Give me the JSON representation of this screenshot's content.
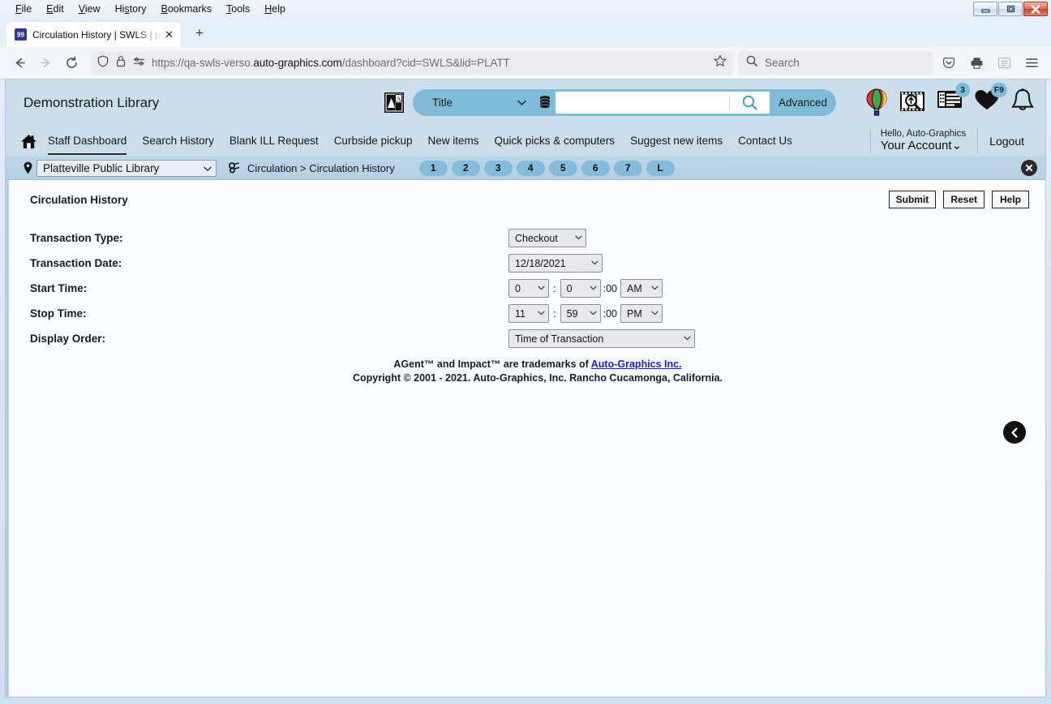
{
  "browser": {
    "menus": [
      "File",
      "Edit",
      "View",
      "History",
      "Bookmarks",
      "Tools",
      "Help"
    ],
    "tab_title": "Circulation History | SWLS | plat",
    "new_tab_label": "+",
    "tab_close_label": "✕",
    "url": "https://qa-swls-verso.auto-graphics.com/dashboard?cid=SWLS&lid=PLATT",
    "url_host_bold": "auto-graphics.com",
    "url_prefix": "https://qa-swls-verso.",
    "url_suffix": "/dashboard?cid=SWLS&lid=PLATT",
    "search_placeholder": "Search",
    "window_controls": {
      "minimize": "–",
      "maximize": "□",
      "close": "✕"
    }
  },
  "site": {
    "library_name": "Demonstration Library",
    "search": {
      "type_label": "Title",
      "input_value": "",
      "advanced_label": "Advanced"
    },
    "header_icons": [
      {
        "name": "hot-air-balloon-icon",
        "badge": ""
      },
      {
        "name": "film-search-icon",
        "badge": ""
      },
      {
        "name": "list-records-icon",
        "badge": "3"
      },
      {
        "name": "heart-favorites-icon",
        "badge": "F9"
      },
      {
        "name": "bell-notifications-icon",
        "badge": ""
      }
    ],
    "nav_links": [
      "Staff Dashboard",
      "Search History",
      "Blank ILL Request",
      "Curbside pickup",
      "New items",
      "Quick picks & computers",
      "Suggest new items",
      "Contact Us"
    ],
    "nav_active": "Staff Dashboard",
    "account": {
      "greeting": "Hello, Auto-Graphics",
      "menu_label": "Your Account",
      "logout_label": "Logout"
    }
  },
  "crumbbar": {
    "library_select_value": "Platteville Public Library",
    "breadcrumb": "Circulation > Circulation History",
    "pills": [
      "1",
      "2",
      "3",
      "4",
      "5",
      "6",
      "7",
      "L"
    ],
    "close_label": "✕"
  },
  "page": {
    "title": "Circulation History",
    "buttons": [
      "Submit",
      "Reset",
      "Help"
    ],
    "fields": [
      {
        "label": "Transaction Type:",
        "value": "Checkout",
        "name": "transaction-type-select",
        "width": 96
      },
      {
        "label": "Transaction Date:",
        "value": "12/18/2021",
        "name": "transaction-date-select",
        "width": 116
      }
    ],
    "start_time": {
      "label": "Start Time:",
      "hour": "0",
      "minute": "0",
      "seconds": ":00",
      "meridiem": "AM"
    },
    "stop_time": {
      "label": "Stop Time:",
      "hour": "11",
      "minute": "59",
      "seconds": ":00",
      "meridiem": "PM"
    },
    "display_order": {
      "label": "Display Order:",
      "value": "Time of Transaction"
    },
    "time_separator": ":"
  },
  "footer": {
    "line1_pre": "AGent™ and Impact™ are trademarks of ",
    "line1_link": "Auto-Graphics Inc.",
    "line2": "Copyright © 2001 - 2021. Auto-Graphics, Inc. Rancho Cucamonga, California."
  }
}
